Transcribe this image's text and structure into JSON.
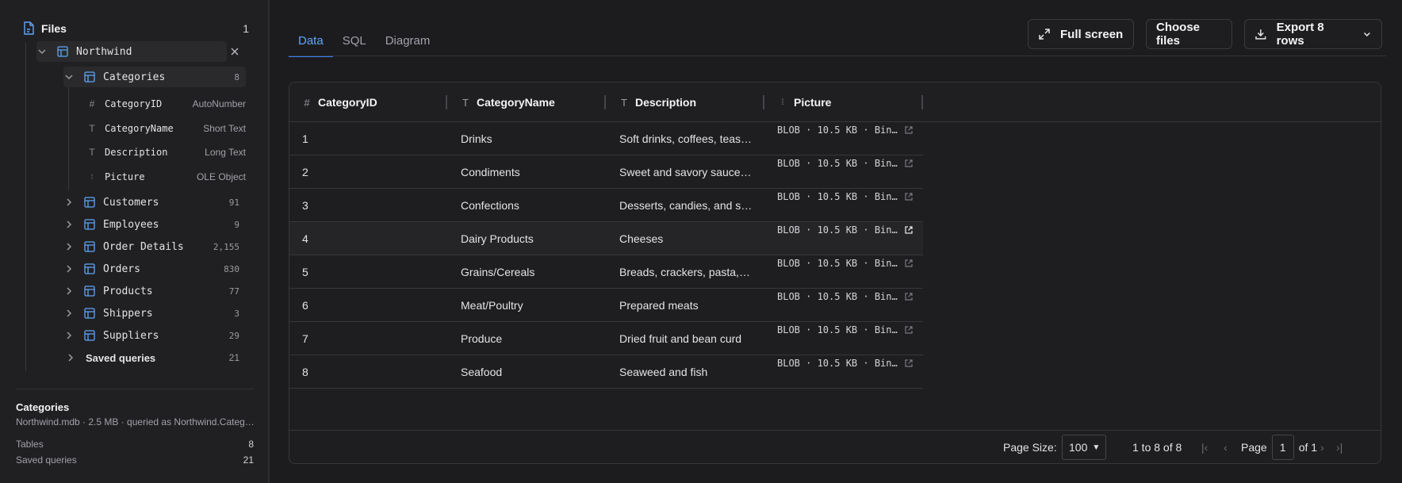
{
  "sidebar": {
    "files_label": "Files",
    "files_count": "1",
    "database": {
      "name": "Northwind"
    },
    "tables": [
      {
        "name": "Categories",
        "count": "8"
      },
      {
        "name": "Customers",
        "count": "91"
      },
      {
        "name": "Employees",
        "count": "9"
      },
      {
        "name": "Order Details",
        "count": "2,155"
      },
      {
        "name": "Orders",
        "count": "830"
      },
      {
        "name": "Products",
        "count": "77"
      },
      {
        "name": "Shippers",
        "count": "3"
      },
      {
        "name": "Suppliers",
        "count": "29"
      }
    ],
    "fields": [
      {
        "name": "CategoryID",
        "type": "AutoNumber",
        "icon": "hash-icon"
      },
      {
        "name": "CategoryName",
        "type": "Short Text",
        "icon": "text-icon"
      },
      {
        "name": "Description",
        "type": "Long Text",
        "icon": "text-icon"
      },
      {
        "name": "Picture",
        "type": "OLE Object",
        "icon": "binary-icon"
      }
    ],
    "saved_queries": {
      "label": "Saved queries",
      "count": "21"
    },
    "info": {
      "title": "Categories",
      "subtitle": "Northwind.mdb · 2.5 MB · queried as Northwind.Categ…",
      "tables_label": "Tables",
      "tables_count": "8",
      "saved_label": "Saved queries",
      "saved_count": "21"
    }
  },
  "tabs": [
    "Data",
    "SQL",
    "Diagram"
  ],
  "active_tab": "Data",
  "toolbar": {
    "fullscreen": "Full screen",
    "choose_files": "Choose files",
    "export": "Export 8 rows"
  },
  "grid": {
    "columns": [
      "CategoryID",
      "CategoryName",
      "Description",
      "Picture"
    ],
    "rows": [
      {
        "id": "1",
        "name": "Drinks",
        "desc": "Soft drinks, coffees, teas, beers, and ales",
        "picture": "BLOB · 10.5 KB · Bin…"
      },
      {
        "id": "2",
        "name": "Condiments",
        "desc": "Sweet and savory sauces, relishes, spreads, and seasonings",
        "picture": "BLOB · 10.5 KB · Bin…"
      },
      {
        "id": "3",
        "name": "Confections",
        "desc": "Desserts, candies, and sweet breads",
        "picture": "BLOB · 10.5 KB · Bin…"
      },
      {
        "id": "4",
        "name": "Dairy Products",
        "desc": "Cheeses",
        "picture": "BLOB · 10.5 KB · Bin…"
      },
      {
        "id": "5",
        "name": "Grains/Cereals",
        "desc": "Breads, crackers, pasta, and cereal",
        "picture": "BLOB · 10.5 KB · Bin…"
      },
      {
        "id": "6",
        "name": "Meat/Poultry",
        "desc": "Prepared meats",
        "picture": "BLOB · 10.5 KB · Bin…"
      },
      {
        "id": "7",
        "name": "Produce",
        "desc": "Dried fruit and bean curd",
        "picture": "BLOB · 10.5 KB · Bin…"
      },
      {
        "id": "8",
        "name": "Seafood",
        "desc": "Seaweed and fish",
        "picture": "BLOB · 10.5 KB · Bin…"
      }
    ]
  },
  "pagination": {
    "page_size_label": "Page Size:",
    "page_size": "100",
    "range": "1 to 8 of 8",
    "page_label": "Page",
    "page": "1",
    "of_label": "of 1"
  },
  "colors": {
    "accent": "#3b82f6",
    "table_icon": "#60a5fa"
  }
}
